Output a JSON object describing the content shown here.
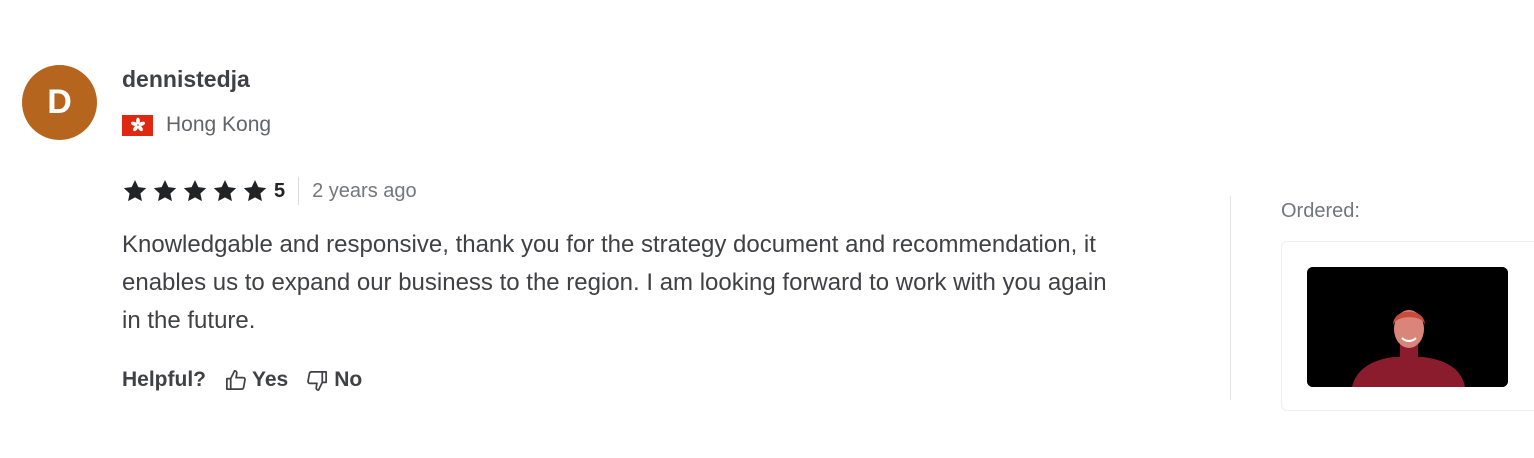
{
  "review": {
    "avatar_initial": "D",
    "avatar_color": "#b5651e",
    "username": "dennistedja",
    "country": "Hong Kong",
    "flag_icon": "hong-kong-flag-icon",
    "rating_stars": 5,
    "rating_value": "5",
    "time_ago": "2 years ago",
    "text": "Knowledgable and responsive, thank you for the strategy document and recommendation, it enables us to expand our business to the region. I am looking forward to work with you again in the future.",
    "helpful_label": "Helpful?",
    "yes_label": "Yes",
    "no_label": "No"
  },
  "ordered": {
    "label": "Ordered:",
    "thumbnail_icon": "gig-thumbnail-image"
  },
  "colors": {
    "star": "#222325",
    "text": "#404145",
    "muted": "#74767e",
    "flag_red": "#de2910"
  }
}
